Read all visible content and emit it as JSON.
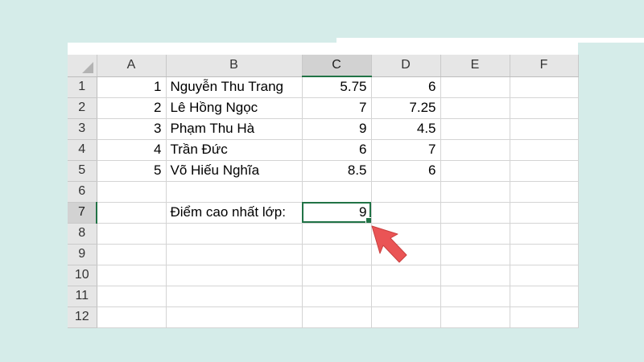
{
  "colors": {
    "background": "#d5ece9",
    "selection": "#217346",
    "header": "#e6e6e6",
    "header_selected": "#d2d2d2",
    "arrow": "#ea5455"
  },
  "columns": [
    "A",
    "B",
    "C",
    "D",
    "E",
    "F"
  ],
  "selected_cell": {
    "column": "C",
    "row": "7"
  },
  "rows": [
    {
      "row": "1",
      "cells": [
        "1",
        "Nguyễn Thu Trang",
        "5.75",
        "6",
        "",
        ""
      ]
    },
    {
      "row": "2",
      "cells": [
        "2",
        "Lê Hồng Ngọc",
        "7",
        "7.25",
        "",
        ""
      ]
    },
    {
      "row": "3",
      "cells": [
        "3",
        "Phạm Thu Hà",
        "9",
        "4.5",
        "",
        ""
      ]
    },
    {
      "row": "4",
      "cells": [
        "4",
        "Trần Đức",
        "6",
        "7",
        "",
        ""
      ]
    },
    {
      "row": "5",
      "cells": [
        "5",
        "Võ Hiếu Nghĩa",
        "8.5",
        "6",
        "",
        ""
      ]
    },
    {
      "row": "6",
      "cells": [
        "",
        "",
        "",
        "",
        "",
        ""
      ]
    },
    {
      "row": "7",
      "cells": [
        "",
        "Điểm cao nhất lớp:",
        "9",
        "",
        "",
        ""
      ]
    },
    {
      "row": "8",
      "cells": [
        "",
        "",
        "",
        "",
        "",
        ""
      ]
    },
    {
      "row": "9",
      "cells": [
        "",
        "",
        "",
        "",
        "",
        ""
      ]
    },
    {
      "row": "10",
      "cells": [
        "",
        "",
        "",
        "",
        "",
        ""
      ]
    },
    {
      "row": "11",
      "cells": [
        "",
        "",
        "",
        "",
        "",
        ""
      ]
    },
    {
      "row": "12",
      "cells": [
        "",
        "",
        "",
        "",
        "",
        ""
      ]
    }
  ],
  "arrow_icon": "pointer-arrow-icon"
}
